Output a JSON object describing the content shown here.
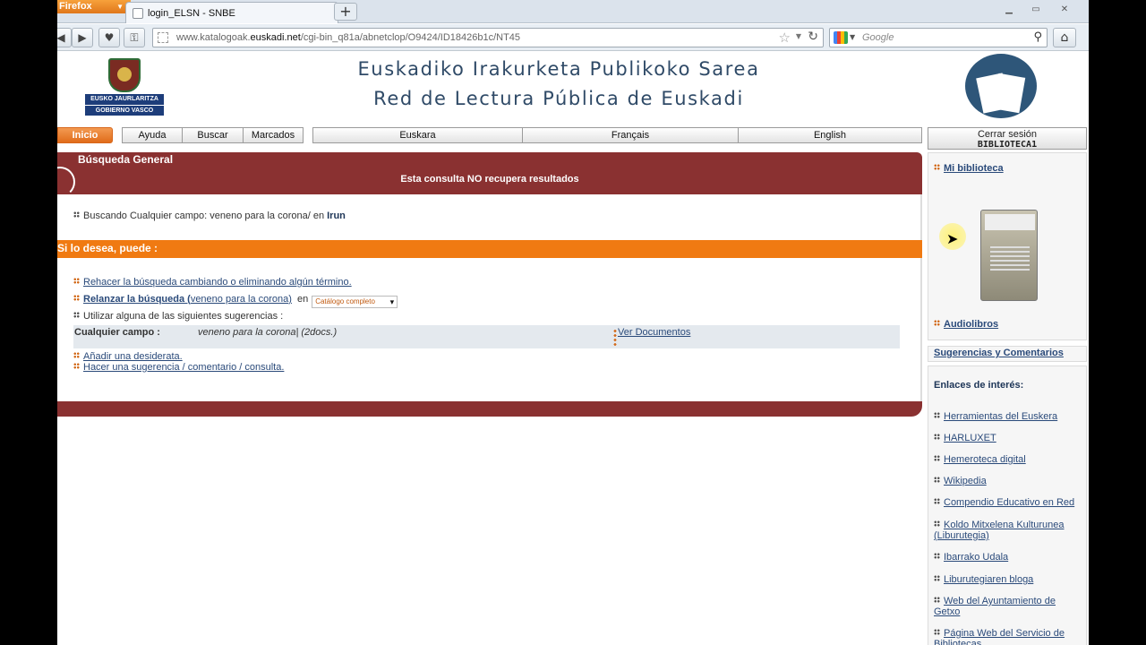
{
  "browser": {
    "firefox_label": "Firefox",
    "tab_title": "login_ELSN - SNBE",
    "new_tab": "+",
    "url_host_prefix": "www.katalogoak.",
    "url_host_main": "euskadi.net",
    "url_path": "/cgi-bin_q81a/abnetclop/O9424/ID18426b1c/NT45",
    "search_placeholder": "Google",
    "win_min": "▁",
    "win_max": "▭",
    "win_close": "✕"
  },
  "header": {
    "gov_logo_line1": "EUSKO JAURLARITZA",
    "gov_logo_line2": "GOBIERNO VASCO",
    "title_line1": "Euskadiko Irakurketa Publikoko Sarea",
    "title_line2": "Red de Lectura Pública de Euskadi"
  },
  "menu": {
    "inicio": "Inicio",
    "ayuda": "Ayuda",
    "buscar": "Buscar",
    "marcados": "Marcados",
    "euskara": "Euskara",
    "francais": "Français",
    "english": "English"
  },
  "session": {
    "logout": "Cerrar sesión",
    "user": "BIBLIOTECA1"
  },
  "main": {
    "section_title": "Búsqueda General",
    "result_message": "Esta consulta NO recupera resultados",
    "searching_prefix": "Buscando Cualquier campo: veneno para la corona/ en ",
    "searching_library": "Irun",
    "options_header": "Si lo desea, puede :",
    "redo_link": "Rehacer la búsqueda cambiando o eliminando algún término.",
    "relaunch_bold": "Relanzar la búsqueda (",
    "relaunch_terms": "veneno para la corona",
    "relaunch_close": ")",
    "relaunch_in": "en",
    "catalog_select": "Catálogo completo",
    "suggestions_text": "Utilizar alguna de las siguientes sugerencias :",
    "suggest_key": "Cualquier campo :",
    "suggest_value": "veneno para la corona| (2docs.)",
    "suggest_link": "Ver Documentos",
    "desiderata_link": "Añadir una desiderata.",
    "suggestion_link": "Hacer una sugerencia / comentario / consulta."
  },
  "sidebar": {
    "my_library": "Mi biblioteca",
    "audiobooks": "Audiolibros",
    "suggestions": "Sugerencias y Comentarios",
    "links_header": "Enlaces de interés:",
    "links": [
      "Herramientas del Euskera",
      "HARLUXET",
      "Hemeroteca digital",
      "Wikipedia",
      "Compendio Educativo en Red",
      "Koldo Mitxelena Kulturunea (Liburutegia)",
      "Ibarrako Udala",
      "Liburutegiaren bloga",
      "Web del Ayuntamiento de Getxo",
      "Página Web del Servicio de Bibliotecas"
    ]
  },
  "colors": {
    "header_red": "#8a3131",
    "orange": "#f07a12",
    "link_blue": "#2a4a7a"
  }
}
